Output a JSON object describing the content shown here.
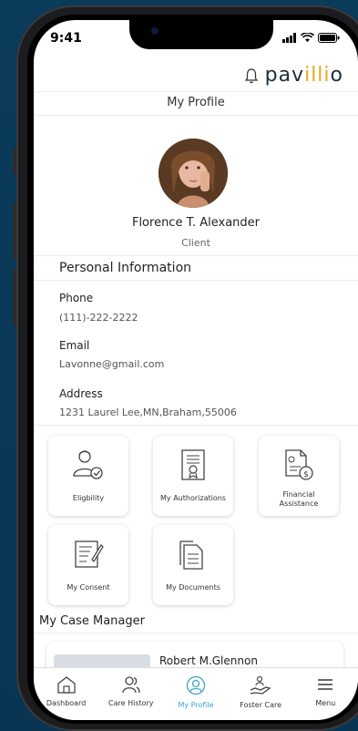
{
  "status": {
    "time": "9:41"
  },
  "header": {
    "logo_left": "pav",
    "logo_mid": "illi",
    "logo_right": "o"
  },
  "title": "My Profile",
  "profile": {
    "name": "Florence T. Alexander",
    "role": "Client"
  },
  "personal": {
    "heading": "Personal Information",
    "phone_label": "Phone",
    "phone": "(111)-222-2222",
    "email_label": "Email",
    "email": "Lavonne@gmail.com",
    "address_label": "Address",
    "address": "1231 Laurel Lee,MN,Braham,55006"
  },
  "tiles": [
    {
      "label": "Eligbility"
    },
    {
      "label": "My Authorizations"
    },
    {
      "label": "Financial Assistance"
    },
    {
      "label": "My Consent"
    },
    {
      "label": "My Documents"
    }
  ],
  "case_manager": {
    "heading": "My Case Manager",
    "name": "Robert M.Glennon"
  },
  "tabs": [
    {
      "label": "Dashboard"
    },
    {
      "label": "Care History"
    },
    {
      "label": "My Profile"
    },
    {
      "label": "Foster Care"
    },
    {
      "label": "Menu"
    }
  ],
  "colors": {
    "accent": "#3aa3c8",
    "logo": "#f0a51a",
    "background": "#0b3b5b"
  }
}
